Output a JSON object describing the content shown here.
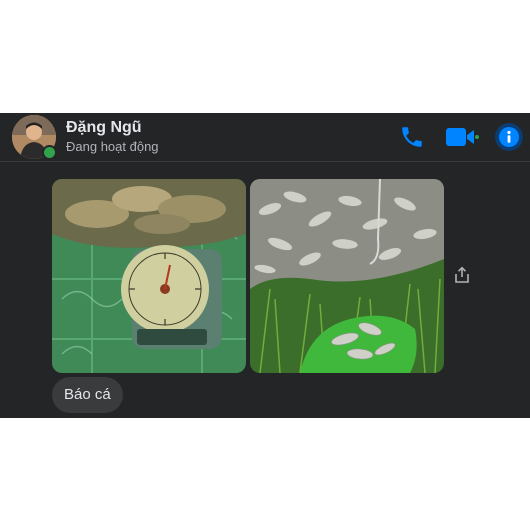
{
  "contact": {
    "name": "Đặng Ngũ",
    "status": "Đang hoạt động"
  },
  "header_icons": [
    "phone-icon",
    "video-camera-icon",
    "info-icon"
  ],
  "message": {
    "photos": [
      "scale-with-fish-photo",
      "fish-on-grass-photo"
    ],
    "text": "Báo cá"
  },
  "colors": {
    "chat_background": "#242526",
    "accent": "#0084ff",
    "online": "#31a24c",
    "bubble": "#3a3b3c",
    "text_primary": "#e4e6eb",
    "text_secondary": "#b0b3b8"
  }
}
